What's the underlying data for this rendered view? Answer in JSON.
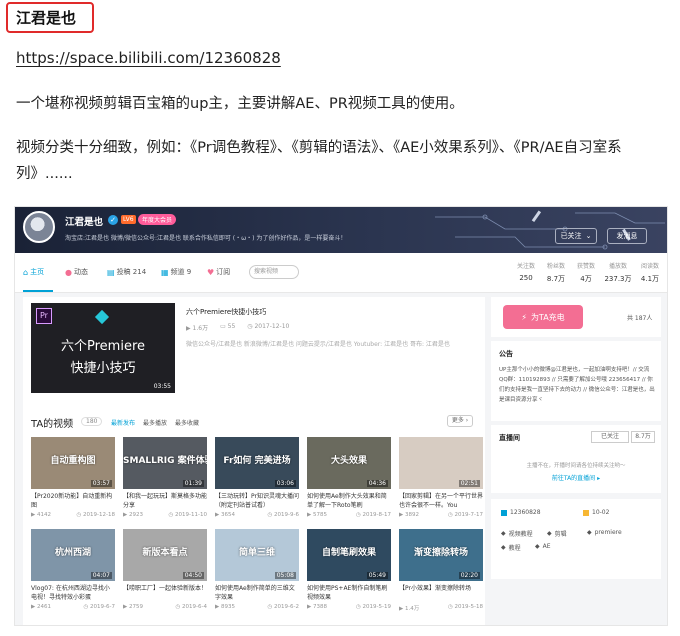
{
  "article": {
    "heading": "江君是也",
    "url": "https://space.bilibili.com/12360828",
    "paragraph1": "一个堪称视频剪辑百宝箱的up主，主要讲解AE、PR视频工具的使用。",
    "paragraph2": "视频分类十分细致，例如：《Pr调色教程》、《剪辑的语法》、《AE小效果系列》、《PR/AE自习室系列》......"
  },
  "profile": {
    "name": "江君是也",
    "level": "LV6",
    "vip": "年度大会员",
    "signature": "淘宝店:江君是也 微博/微信公众号:江君是也 联系合作私信即可 (・ω・) 为了创作好作品，是一样要奋斗！",
    "follow_label": "已关注",
    "message_label": "发消息",
    "stats": [
      {
        "label": "关注数",
        "value": "250"
      },
      {
        "label": "粉丝数",
        "value": "8.7万"
      },
      {
        "label": "获赞数",
        "value": "4万"
      },
      {
        "label": "播放数",
        "value": "237.3万"
      },
      {
        "label": "阅读数",
        "value": "4.1万"
      }
    ]
  },
  "nav": {
    "items": [
      {
        "label": "主页",
        "icon": "home-icon"
      },
      {
        "label": "动态",
        "icon": "dynamic-icon"
      },
      {
        "label": "投稿 214",
        "icon": "upload-icon"
      },
      {
        "label": "频道 9",
        "icon": "channel-icon"
      },
      {
        "label": "订阅",
        "icon": "heart-icon"
      }
    ],
    "search_placeholder": "搜索视频"
  },
  "featured": {
    "thumb_line1": "六个Premiere",
    "thumb_line2": "快捷小技巧",
    "duration": "03:55",
    "title": "六个Premiere快捷小技巧",
    "plays": "1.6万",
    "comments": "55",
    "date": "2017-12-10",
    "desc": "微信公众号/江君是也 新浪微博/江君是也 问题云提示/江君是也 Youtuber: 江君是也 哥布: 江君是也"
  },
  "videos_section": {
    "title": "TA的视频",
    "count": "180",
    "sorts": [
      "最新发布",
      "最多播放",
      "最多收藏"
    ],
    "more": "更多"
  },
  "videos": [
    {
      "cap": "自动重构图",
      "dur": "03:57",
      "title": "【Pr2020新功能】自动重新构图",
      "plays": "4142",
      "date": "2019-12-18",
      "bg": "#9a8a76"
    },
    {
      "cap": "SMALLRIG 案件体验",
      "dur": "01:39",
      "title": "【和我一起玩玩】斯莫格多功能分享",
      "plays": "2923",
      "date": "2019-11-10",
      "bg": "#555a61"
    },
    {
      "cap": "Fr如何 完美进场",
      "dur": "03:06",
      "title": "【三动玩转】Pr知识灵魂大播问（附定刊站普试看）",
      "plays": "3654",
      "date": "2019-9-6",
      "bg": "#384a5a"
    },
    {
      "cap": "大头效果",
      "dur": "04:36",
      "title": "如何使用Ae制作大头效果和简单了解一下Roto笔刷",
      "plays": "5785",
      "date": "2019-8-17",
      "bg": "#6a6a5e"
    },
    {
      "cap": "",
      "dur": "02:51",
      "title": "【回家剪辑】在另一个平行世界也许会很不一样。You",
      "plays": "3892",
      "date": "2019-7-17",
      "bg": "#d7ccc2"
    },
    {
      "cap": "杭州西湖",
      "dur": "04:07",
      "title": "Vlog07: 在杭州西湖边寻找小电视！寻找特效小彩蛋",
      "plays": "2461",
      "date": "2019-6-7",
      "bg": "#7f95a8"
    },
    {
      "cap": "新版本看点",
      "dur": "04:50",
      "title": "【唠职工厂】一起体验新版本！",
      "plays": "2759",
      "date": "2019-6-4",
      "bg": "#a8a8a8"
    },
    {
      "cap": "简单三维",
      "dur": "05:08",
      "title": "如何使用Ae制作简单的三维文字效果",
      "plays": "8935",
      "date": "2019-6-2",
      "bg": "#b4c8d8"
    },
    {
      "cap": "自制笔刷效果",
      "dur": "05:49",
      "title": "如何使用PS+AE制作自制笔刷视频效果",
      "plays": "7388",
      "date": "2019-5-19",
      "bg": "#2f4a60"
    },
    {
      "cap": "渐变擦除转场",
      "dur": "02:20",
      "title": "【Pr小效果】渐变擦除转场",
      "plays": "1.4万",
      "date": "2019-5-18",
      "bg": "#3e6f8c"
    }
  ],
  "side": {
    "charge_label": "为TA充电",
    "charge_count": "共 187人",
    "notice_title": "公告",
    "notice_text": "UP主那个小小的微博@江君是也，一起加油啊支持吧！// 交流QQ群：110192893 // 只需要了解加公号哦 223656417 // 你们的支持是我一直坚持下去的动力 // 微信公众号：江君是也，出是课目资源分享ヾ",
    "live_title": "直播间",
    "live_follow": "已关注",
    "live_count": "8.7万",
    "live_text1": "主播不在，开播时间请各位持续关注哟～",
    "live_text2": "前往TA的直播间 ▸",
    "uid": "12360828",
    "birthday": "10-02",
    "tags": [
      "视频教程",
      "剪辑",
      "premiere",
      "教程",
      "AE"
    ]
  }
}
